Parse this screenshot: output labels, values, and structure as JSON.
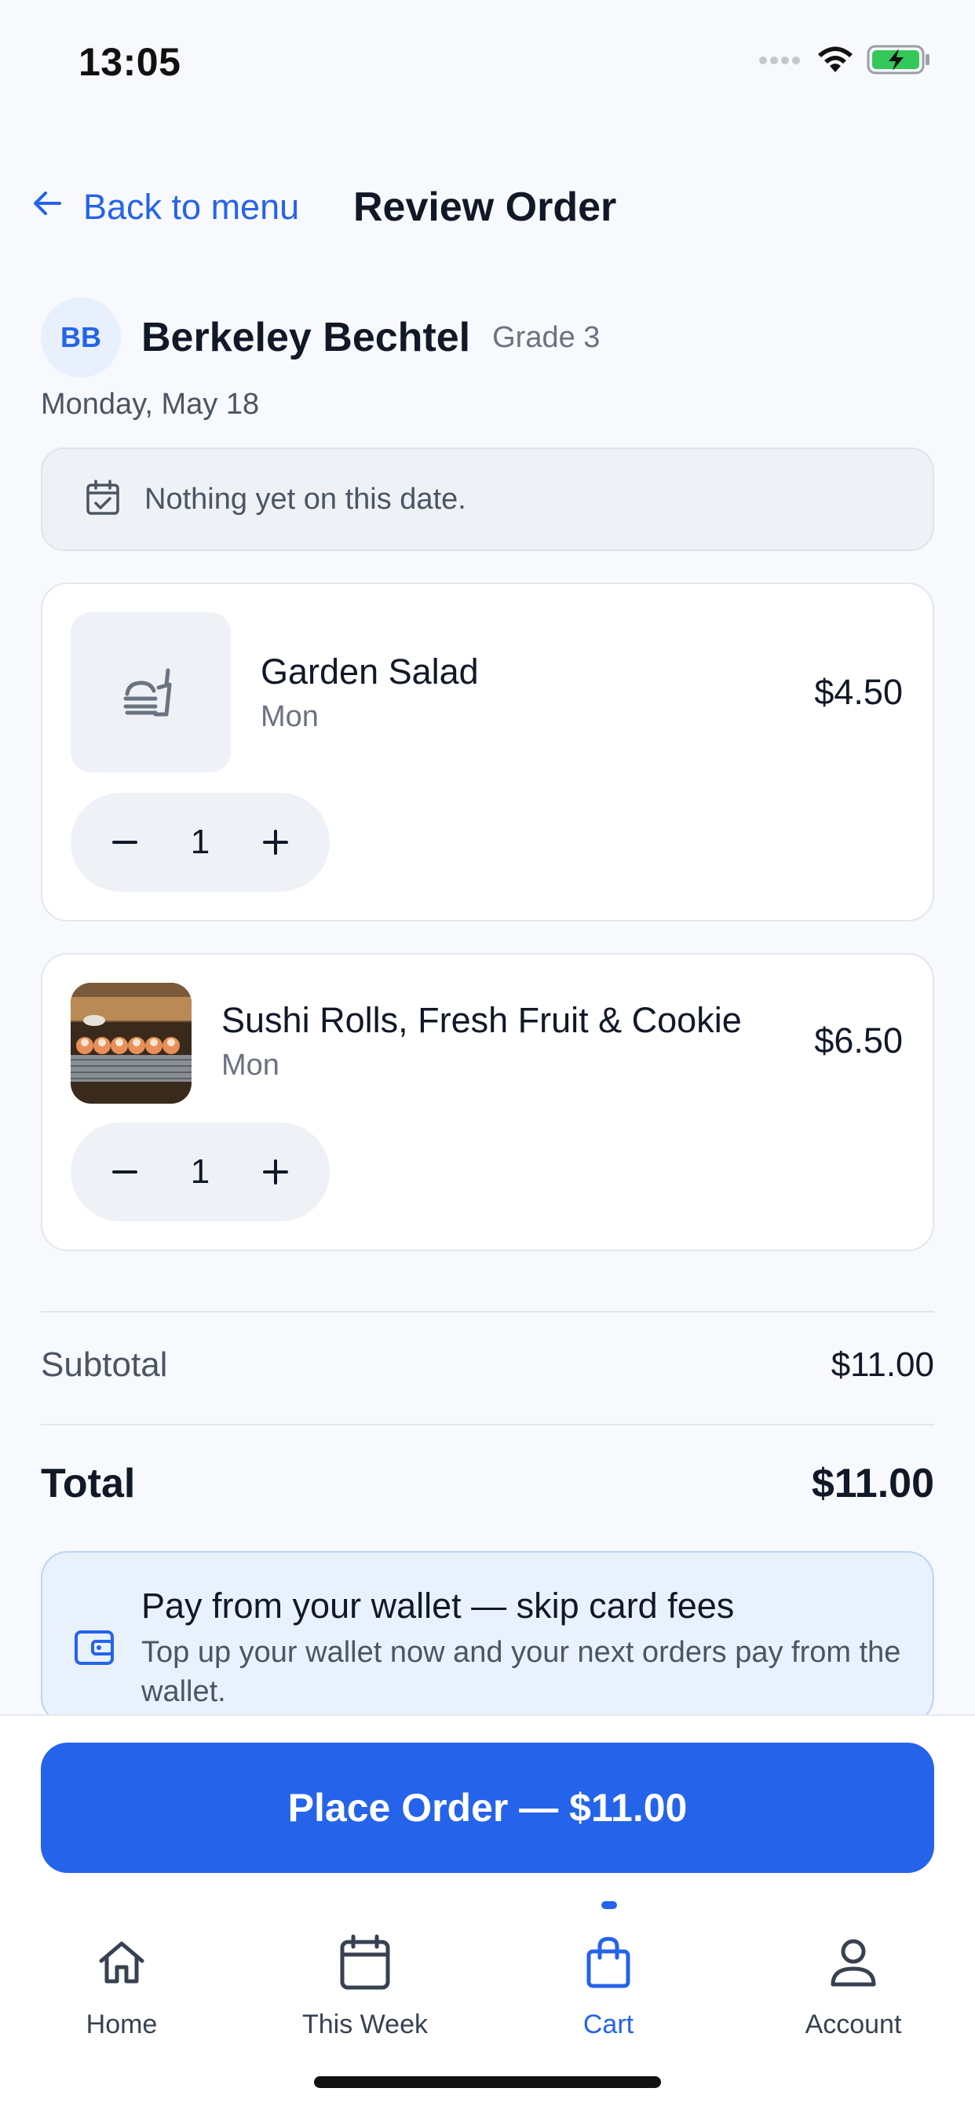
{
  "status_bar": {
    "time": "13:05"
  },
  "header": {
    "back_label": "Back to menu",
    "title": "Review Order"
  },
  "student": {
    "initials": "BB",
    "name": "Berkeley Bechtel",
    "grade": "Grade 3",
    "date": "Monday, May 18"
  },
  "notice": {
    "text": "Nothing yet on this date."
  },
  "items": [
    {
      "name": "Garden Salad",
      "day": "Mon",
      "price": "$4.50",
      "quantity": "1"
    },
    {
      "name": "Sushi Rolls, Fresh Fruit & Cookie",
      "day": "Mon",
      "price": "$6.50",
      "quantity": "1"
    }
  ],
  "totals": {
    "subtotal_label": "Subtotal",
    "subtotal": "$11.00",
    "total_label": "Total",
    "total": "$11.00"
  },
  "wallet_promo": {
    "title": "Pay from your wallet — skip card fees",
    "subtitle": "Top up your wallet now and your next orders pay from the wallet."
  },
  "place_order": {
    "label": "Place Order — $11.00"
  },
  "tabs": [
    {
      "label": "Home",
      "icon": "home-icon"
    },
    {
      "label": "This Week",
      "icon": "calendar-icon"
    },
    {
      "label": "Cart",
      "icon": "shopping-bag-icon",
      "active": true
    },
    {
      "label": "Account",
      "icon": "user-icon"
    }
  ],
  "colors": {
    "accent": "#2563eb",
    "background": "#f8f9fc",
    "card": "#ffffff",
    "text": "#111827",
    "muted": "#6b7280"
  }
}
